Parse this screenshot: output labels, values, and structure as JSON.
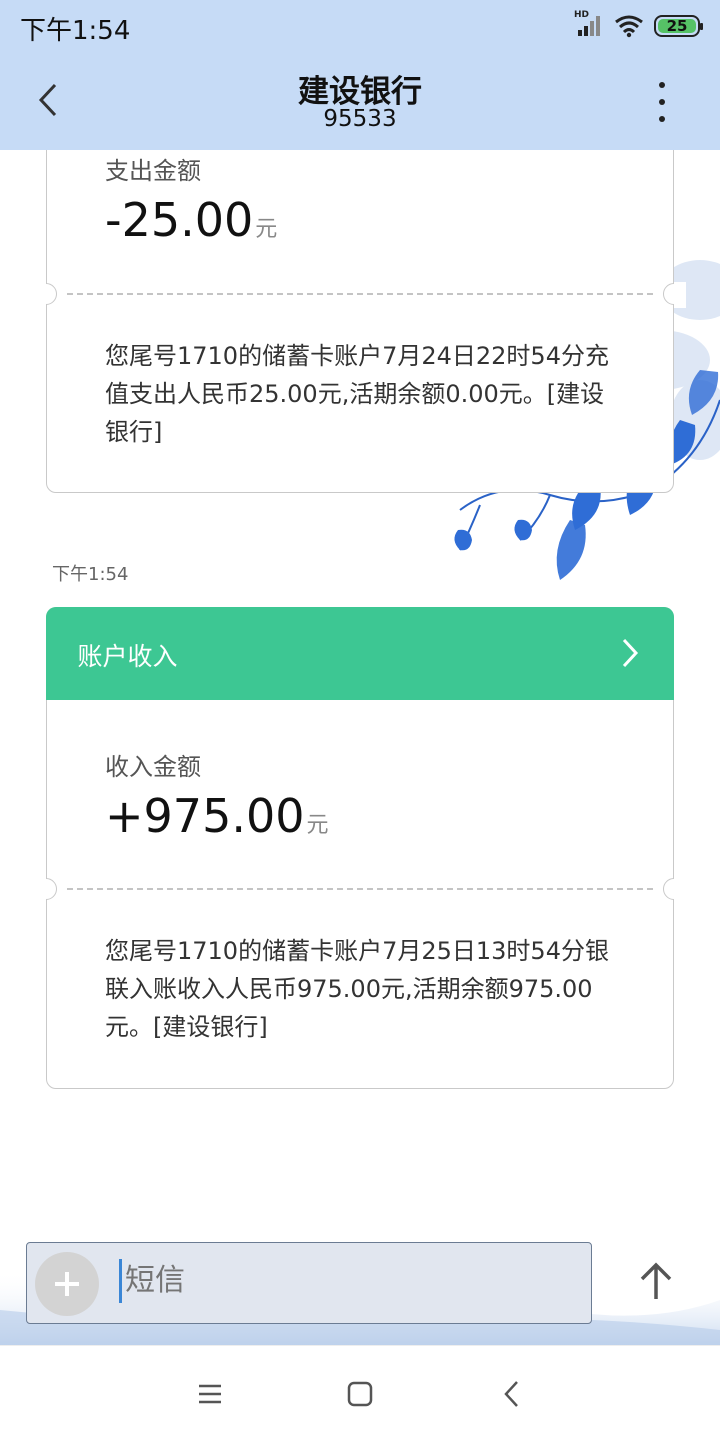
{
  "status_bar": {
    "time": "下午1:54",
    "network": "HD",
    "battery": "25",
    "icons": [
      "signal-icon",
      "wifi-icon",
      "battery-icon"
    ]
  },
  "header": {
    "title": "建设银行",
    "number": "95533",
    "back_icon": "back-arrow-icon",
    "more_icon": "more-vertical-icon"
  },
  "messages": [
    {
      "amount_label": "支出金额",
      "amount": "-25.00",
      "unit": "元",
      "body": "您尾号1710的储蓄卡账户7月24日22时54分充值支出人民币25.00元,活期余额0.00元。[建设银行]"
    },
    {
      "timestamp": "下午1:54",
      "card_title": "账户收入",
      "card_color": "#3dc793",
      "amount_label": "收入金额",
      "amount": "+975.00",
      "unit": "元",
      "body": "您尾号1710的储蓄卡账户7月25日13时54分银联入账收入人民币975.00元,活期余额975.00元。[建设银行]"
    }
  ],
  "composer": {
    "placeholder": "短信",
    "add_icon": "plus-icon",
    "send_icon": "send-arrow-icon"
  },
  "colors": {
    "header_bg": "#c6dbf6",
    "accent": "#3dc793",
    "cursor": "#3a86d6"
  },
  "navbar": {
    "icons": [
      "menu-icon",
      "home-icon",
      "back-icon"
    ]
  }
}
